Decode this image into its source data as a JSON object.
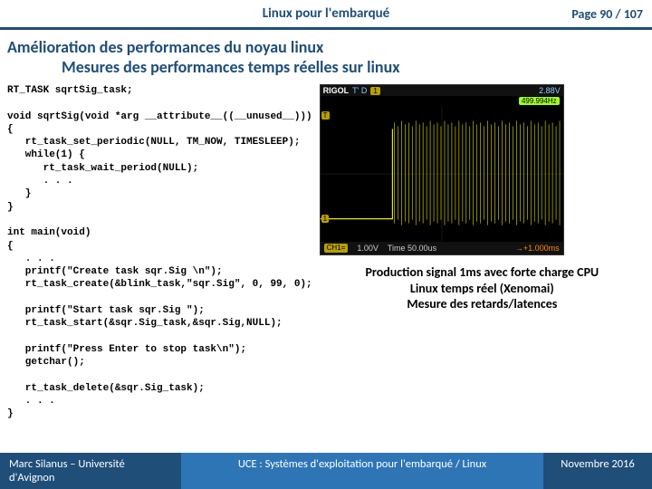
{
  "header": {
    "title": "Linux pour l'embarqué",
    "page": "Page 90 / 107"
  },
  "titles": {
    "line1": "Amélioration des performances du noyau linux",
    "line2": "Mesures des performances temps réelles sur linux"
  },
  "code": "RT_TASK sqrtSig_task;\n\nvoid sqrtSig(void *arg __attribute__((__unused__)))\n{\n   rt_task_set_periodic(NULL, TM_NOW, TIMESLEEP);\n   while(1) {\n      rt_task_wait_period(NULL);\n      . . .\n   }\n}\n\nint main(void)\n{\n   . . .\n   printf(\"Create task sqr.Sig \\n\");\n   rt_task_create(&blink_task,\"sqr.Sig\", 0, 99, 0);\n\n   printf(\"Start task sqr.Sig \");\n   rt_task_start(&sqr.Sig_task,&sqr.Sig,NULL);\n\n   printf(\"Press Enter to stop task\\n\");\n   getchar();\n\n   rt_task_delete(&sqr.Sig_task);\n   . . .\n}",
  "scope": {
    "brand": "RIGOL",
    "mode": "T' D",
    "badge1": "1",
    "vreading": "2.88V",
    "hz": "499.994Hz",
    "markerT": "T",
    "marker1": "1",
    "ch1": "CH1=",
    "ch1v": "1.00V",
    "time": "Time 50.00us",
    "tplus": "→+1.000ms"
  },
  "caption": {
    "l1": "Production signal 1ms avec forte charge CPU",
    "l2": "Linux temps réel (Xenomai)",
    "l3": "Mesure des retards/latences"
  },
  "footer": {
    "left": "Marc Silanus – Université d'Avignon",
    "mid": "UCE : Systèmes d'exploitation pour l'embarqué / Linux",
    "right": "Novembre 2016"
  }
}
